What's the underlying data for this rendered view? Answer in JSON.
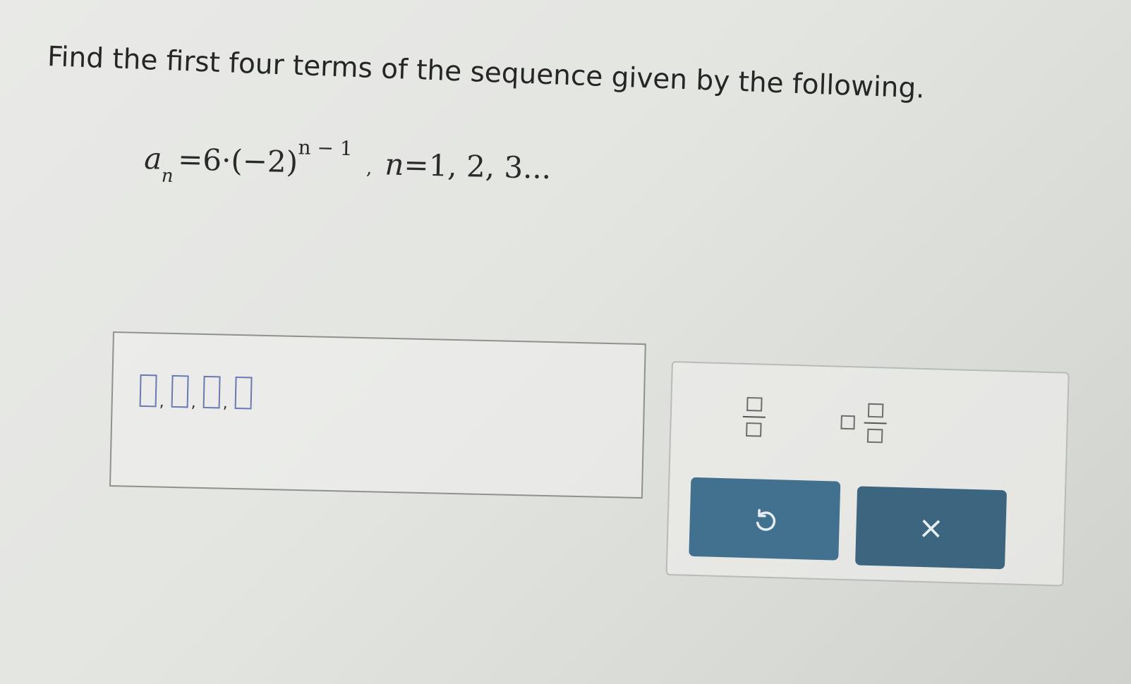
{
  "question": {
    "text": "Find the first four terms of the sequence given by the following."
  },
  "formula": {
    "lhs_var": "a",
    "lhs_sub": "n",
    "equals": "=",
    "coefficient": "6·(−2)",
    "exponent": "n − 1",
    "separator": ",",
    "domain_var": "n",
    "domain_values": "=1, 2, 3..."
  },
  "answer": {
    "slots": [
      ",",
      ",",
      ","
    ]
  },
  "tools": {
    "undo_label": "Undo",
    "clear_label": "×",
    "fraction_label": "Fraction",
    "mixed_label": "Mixed number"
  },
  "colors": {
    "button": "#42718f",
    "slot_border": "#6a7ab0"
  }
}
